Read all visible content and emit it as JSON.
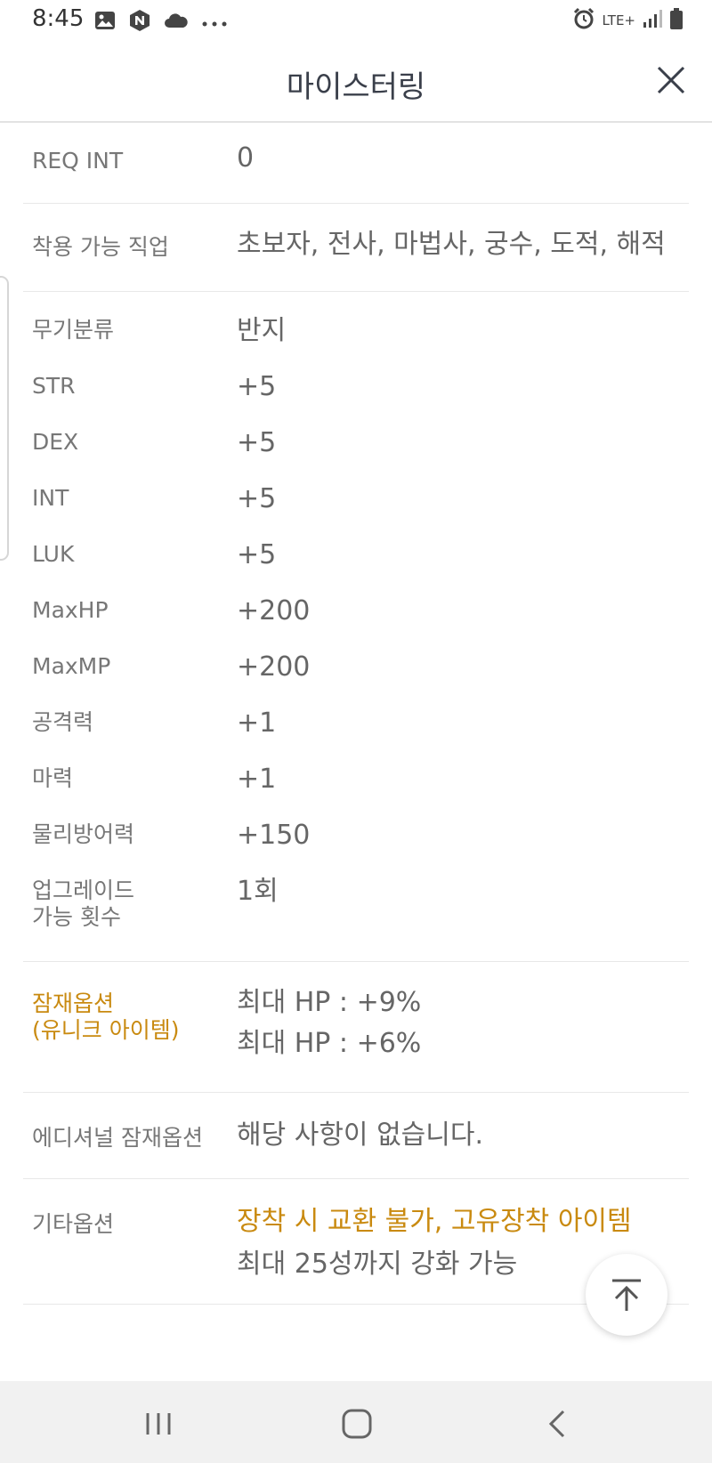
{
  "status": {
    "time": "8:45",
    "left_icons": [
      "image-icon",
      "naver-icon",
      "cloud-icon",
      "more-dots-icon"
    ],
    "right_icons": [
      "alarm-icon",
      "lte-icon",
      "signal-icon",
      "battery-icon"
    ],
    "network": "LTE+"
  },
  "header": {
    "title": "마이스터링"
  },
  "details": {
    "req_int": {
      "label": "REQ INT",
      "value": "0"
    },
    "jobs": {
      "label": "착용 가능 직업",
      "value": "초보자, 전사, 마법사, 궁수, 도적, 해적"
    },
    "stats": [
      {
        "label": "무기분류",
        "value": "반지"
      },
      {
        "label": "STR",
        "value": "+5"
      },
      {
        "label": "DEX",
        "value": "+5"
      },
      {
        "label": "INT",
        "value": "+5"
      },
      {
        "label": "LUK",
        "value": "+5"
      },
      {
        "label": "MaxHP",
        "value": "+200"
      },
      {
        "label": "MaxMP",
        "value": "+200"
      },
      {
        "label": "공격력",
        "value": "+1"
      },
      {
        "label": "마력",
        "value": "+1"
      },
      {
        "label": "물리방어력",
        "value": "+150"
      }
    ],
    "upgrade": {
      "label_line1": "업그레이드",
      "label_line2": "가능 횟수",
      "value": "1회"
    },
    "potential": {
      "label_line1": "잠재옵션",
      "label_line2": "(유니크 아이템)",
      "values": [
        "최대 HP : +9%",
        "최대 HP : +6%"
      ]
    },
    "additional": {
      "label": "에디셔널 잠재옵션",
      "value": "해당 사항이 없습니다."
    },
    "etc": {
      "label": "기타옵션",
      "value_highlight": "장착 시 교환 불가, 고유장착 아이템",
      "value": "최대 25성까지 강화 가능"
    }
  },
  "colors": {
    "accent": "#c98a10",
    "text": "#666666",
    "label": "#777777",
    "divider": "#e8e8e8"
  }
}
